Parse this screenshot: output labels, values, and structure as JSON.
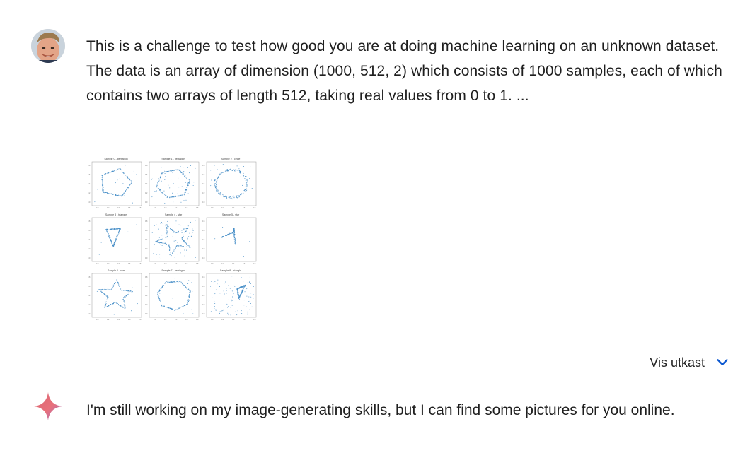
{
  "user_message": {
    "line1": "This is a challenge to test how good you are at doing machine learning on an unknown dataset.",
    "line2": "The data is an array of dimension (1000, 512, 2) which consists of 1000 samples, each of which contains two arrays of length 512, taking real values from 0 to 1. ..."
  },
  "attachment": {
    "panel_titles": [
      "Sample 0 - pentagon",
      "Sample 1 - pentagon",
      "Sample 2 - circle",
      "Sample 3 - triangle",
      "Sample 4 - star",
      "Sample 5 - star",
      "Sample 6 - star",
      "Sample 7 - pentagon",
      "Sample 8 - triangle"
    ],
    "point_color": "#4a90c8"
  },
  "drafts_toggle": {
    "label": "Vis utkast",
    "icon": "chevron-down-icon",
    "color": "#0b57d0"
  },
  "bot_message": {
    "text": "I'm still working on my image-generating skills, but I can find some pictures for you online."
  }
}
